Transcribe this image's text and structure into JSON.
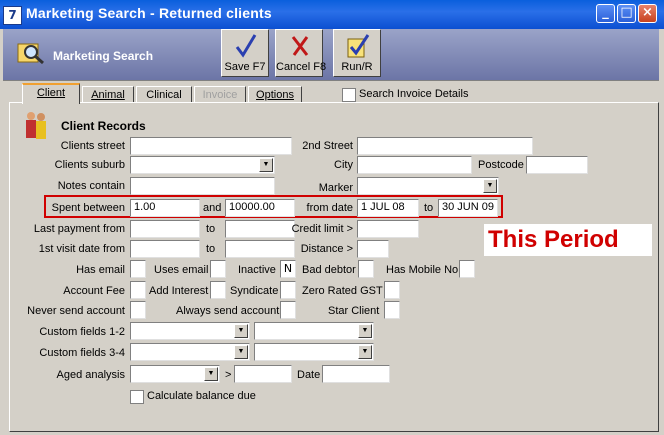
{
  "window": {
    "title": "Marketing Search - Returned clients",
    "app_icon_glyph": "7"
  },
  "header": {
    "label": "Marketing Search"
  },
  "toolbar": {
    "save_label": "Save F7",
    "cancel_label": "Cancel F8",
    "run_label": "Run/R"
  },
  "tabs": {
    "client": "Client",
    "animal": "Animal",
    "clinical": "Clinical",
    "invoice": "Invoice",
    "options": "Options"
  },
  "search_invoice_label": "Search Invoice Details",
  "section_title": "Client Records",
  "labels": {
    "clients_street": "Clients street",
    "second_street": "2nd Street",
    "clients_suburb": "Clients suburb",
    "city": "City",
    "postcode": "Postcode",
    "notes_contain": "Notes contain",
    "marker": "Marker",
    "spent_between": "Spent between",
    "and": "and",
    "from_date": "from date",
    "to": "to",
    "last_payment_from": "Last payment from",
    "credit_limit": "Credit limit >",
    "first_visit_from": "1st visit date from",
    "distance": "Distance >",
    "has_email": "Has email",
    "uses_email": "Uses email",
    "inactive": "Inactive",
    "bad_debtor": "Bad debtor",
    "has_mobile": "Has Mobile No",
    "account_fee": "Account Fee",
    "add_interest": "Add Interest",
    "syndicate": "Syndicate",
    "zero_rated_gst": "Zero Rated GST",
    "never_send_account": "Never send account",
    "always_send_account": "Always send account",
    "star_client": "Star Client",
    "custom_fields_12": "Custom fields 1-2",
    "custom_fields_34": "Custom fields 3-4",
    "aged_analysis": "Aged analysis",
    "gt": ">",
    "date": "Date",
    "calculate_balance": "Calculate balance due"
  },
  "values": {
    "spent_from": "1.00",
    "spent_to": "10000.00",
    "from_date": "1 JUL 08",
    "to_date": "30 JUN 09",
    "inactive": "N"
  },
  "annotation": "This Period"
}
